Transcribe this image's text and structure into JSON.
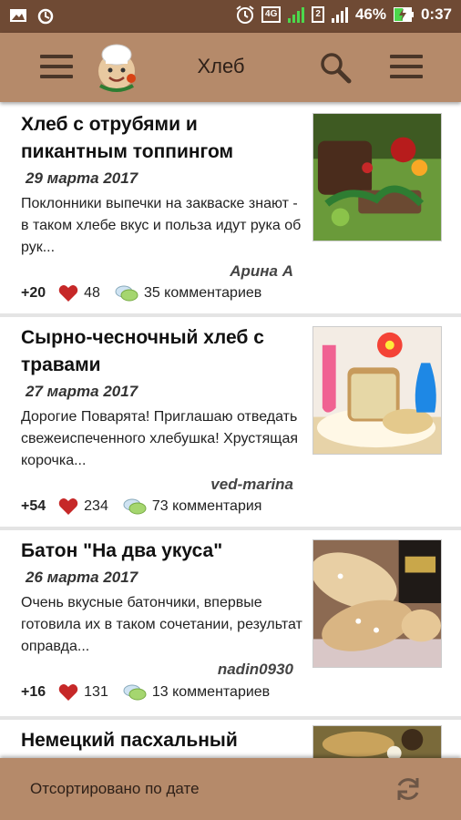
{
  "status_bar": {
    "network": "4G",
    "sim": "2",
    "battery_percent": "46%",
    "time": "0:37"
  },
  "app_bar": {
    "title": "Хлеб",
    "icons": [
      "menu-icon",
      "chef-logo",
      "search-icon",
      "more-menu-icon"
    ]
  },
  "recipes": [
    {
      "title": "Хлеб с отрубями и пикантным топпингом",
      "date": "29 марта 2017",
      "description": "Поклонники выпечки на закваске знают - в таком хлебе вкус и польза идут рука об рук...",
      "author": "Арина А",
      "score": "+20",
      "likes": "48",
      "comments": "35 комментариев"
    },
    {
      "title": "Сырно-чесночный хлеб с травами",
      "date": "27 марта 2017",
      "description": "Дорогие Поварята! Приглашаю отведать свежеиспеченного хлебушка! Хрустящая корочка...",
      "author": "ved-marina",
      "score": "+54",
      "likes": "234",
      "comments": "73 комментария"
    },
    {
      "title": "Батон \"На два укуса\"",
      "date": "26 марта 2017",
      "description": "Очень вкусные батончики, впервые готовила их в таком сочетании, результат оправда...",
      "author": "nadin0930",
      "score": "+16",
      "likes": "131",
      "comments": "13 комментариев"
    },
    {
      "title": "Немецкий пасхальный"
    }
  ],
  "bottom_bar": {
    "sort_label": "Отсортировано по дате"
  },
  "colors": {
    "status_bar": "#6f4a34",
    "app_bar": "#b58a6a",
    "heart": "#c62828",
    "divider": "#e4e4e4"
  }
}
